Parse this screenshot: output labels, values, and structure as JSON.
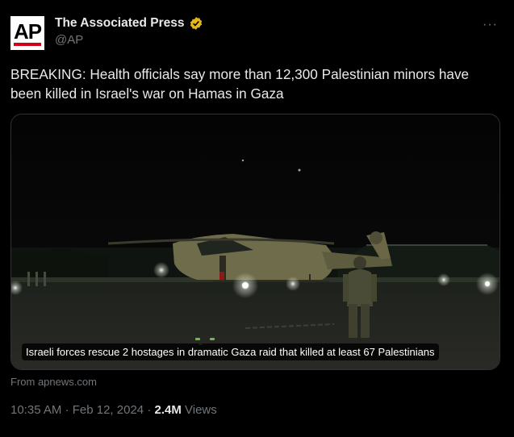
{
  "author": {
    "avatar_text": "AP",
    "name": "The Associated Press",
    "handle": "@AP",
    "verified_icon": "gold-verified-badge",
    "more_icon": "···"
  },
  "tweet": {
    "text": "BREAKING: Health officials say more than 12,300 Palestinian minors have been killed in Israel's war on Hamas in Gaza"
  },
  "link_card": {
    "image_icon": "night-helicopter-photo",
    "caption": "Israeli forces rescue 2 hostages in dramatic Gaza raid that killed at least 67 Palestinians",
    "source": "From apnews.com"
  },
  "meta": {
    "time": "10:35 AM",
    "separator": "·",
    "date": "Feb 12, 2024",
    "views_count": "2.4M",
    "views_label": "Views"
  },
  "colors": {
    "background": "#000000",
    "text": "#e7e9ea",
    "secondary": "#71767b",
    "badge": "#e2b719",
    "ap_red": "#d0021b"
  }
}
